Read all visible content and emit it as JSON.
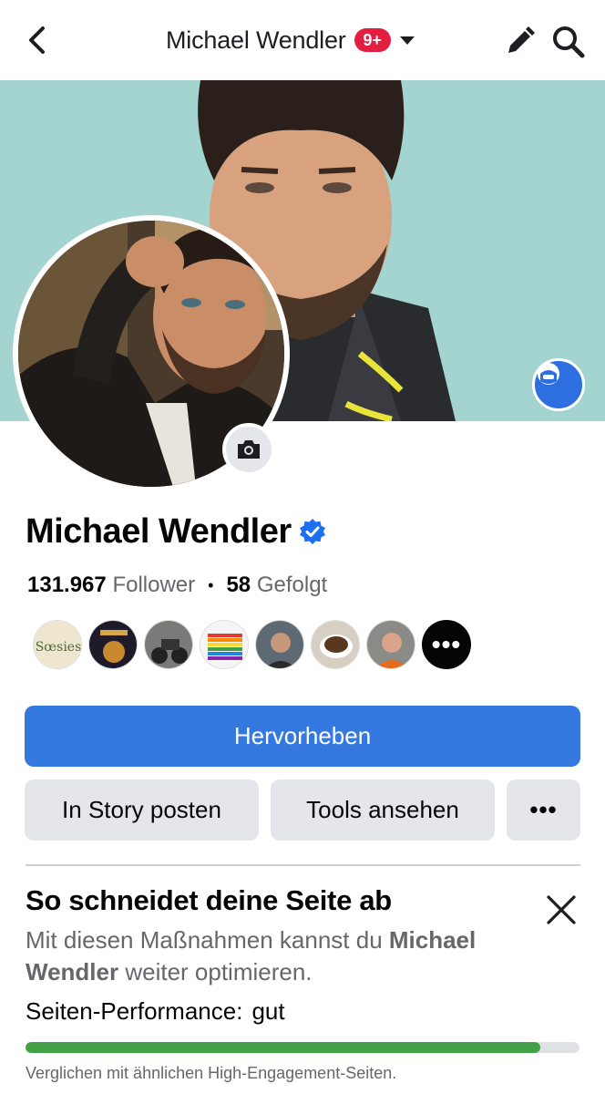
{
  "nav": {
    "page_name": "Michael Wendler",
    "notification_badge": "9+"
  },
  "profile": {
    "name": "Michael Wendler",
    "followers_count": "131.967",
    "followers_label": "Follower",
    "following_count": "58",
    "following_label": "Gefolgt",
    "follower_avatar_more": "•••"
  },
  "actions": {
    "primary_label": "Hervorheben",
    "story_label": "In Story posten",
    "tools_label": "Tools ansehen",
    "more_label": "•••"
  },
  "performance": {
    "title": "So schneidet deine Seite ab",
    "desc_prefix": "Mit diesen Maßnahmen kannst du ",
    "desc_name": "Michael Wendler",
    "desc_suffix": " weiter optimieren.",
    "status_label": "Seiten-Performance:",
    "status_value": "gut",
    "progress_fraction": 0.93,
    "note": "Verglichen mit ähnlichen High-Engagement-Seiten."
  },
  "colors": {
    "accent_blue": "#3478e0",
    "badge_red": "#e41e3f",
    "progress_green": "#43a047",
    "cover_bg": "#a3d4cf"
  },
  "icons": {
    "back": "chevron-left-icon",
    "edit": "pencil-icon",
    "search": "search-icon",
    "caret": "caret-down-icon",
    "verified": "verified-badge-icon",
    "camera": "camera-icon",
    "avatar_frame": "avatar-frame-icon",
    "close": "close-icon"
  }
}
